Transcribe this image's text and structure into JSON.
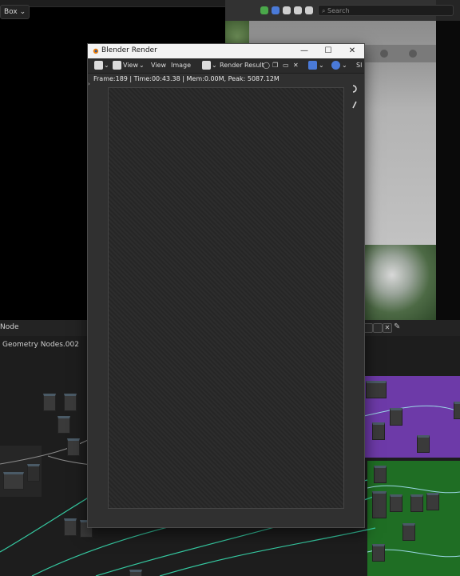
{
  "background": {
    "box_menu_label": "Box ⌄",
    "viewport_search_placeholder": "Search"
  },
  "node_editor": {
    "editor_type_label": "Node",
    "node_tree_name": "Geometry Nodes.002"
  },
  "render_window": {
    "title": "Blender Render",
    "window_controls": {
      "minimize": "—",
      "maximize": "☐",
      "close": "✕"
    },
    "menu": {
      "view": "View",
      "image": "Image",
      "view2": "View"
    },
    "slot_label": "Render Result",
    "stats": "Frame:189 | Time:00:43.38 | Mem:0.00M, Peak: 5087.12M",
    "truncated_label": "Sl"
  },
  "colors": {
    "purple_frame": "#6d3aa8",
    "green_frame": "#1f6e24",
    "wire": "#35c9a1",
    "window_titlebar": "#f3f3f3"
  }
}
